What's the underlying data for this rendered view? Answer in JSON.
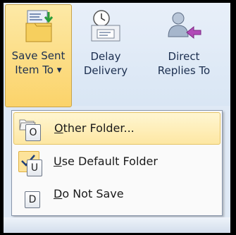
{
  "ribbon": {
    "save_sent": {
      "line1": "Save Sent",
      "line2": "Item To",
      "icon": "save-folder-icon"
    },
    "delay": {
      "line1": "Delay",
      "line2": "Delivery",
      "icon": "clock-envelope-icon"
    },
    "direct": {
      "line1": "Direct",
      "line2": "Replies To",
      "icon": "user-arrow-icon"
    }
  },
  "menu": {
    "items": [
      {
        "accel": "O",
        "rest": "ther Folder...",
        "keytip": "O",
        "highlighted": true,
        "icon": "folder-open-icon"
      },
      {
        "accel": "U",
        "rest": "se Default Folder",
        "keytip": "U",
        "checked": true
      },
      {
        "accel": "D",
        "rest": "o Not Save",
        "keytip": "D"
      }
    ]
  },
  "colors": {
    "highlight": "#fde7a3",
    "ribbon_bg": "#dfe9f5",
    "menu_bg": "#fafafa"
  }
}
